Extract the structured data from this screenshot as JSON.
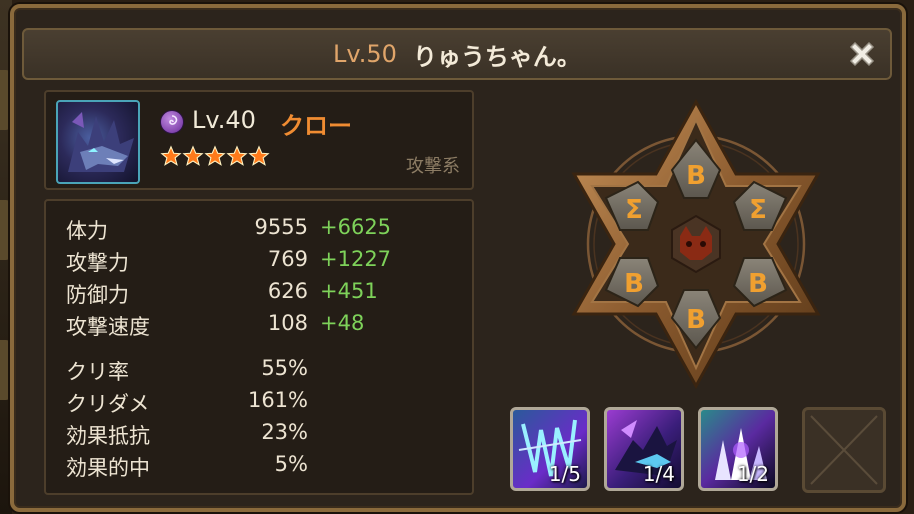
{
  "header": {
    "level_label": "Lv.50",
    "player_name": "りゅうちゃん。",
    "close_icon": "close-x-icon"
  },
  "monster": {
    "element_icon": "dark-element-icon",
    "level_label": "Lv.40",
    "name": "クロー",
    "stars": 5,
    "type": "攻撃系",
    "colors": {
      "name": "#f08c32",
      "bonus": "#7ed25a",
      "star": "#ff7a1a"
    }
  },
  "stats": {
    "main": [
      {
        "label": "体力",
        "base": "9555",
        "bonus": "+6625"
      },
      {
        "label": "攻撃力",
        "base": "769",
        "bonus": "+1227"
      },
      {
        "label": "防御力",
        "base": "626",
        "bonus": "+451"
      },
      {
        "label": "攻撃速度",
        "base": "108",
        "bonus": "+48"
      }
    ],
    "sub": [
      {
        "label": "クリ率",
        "value": "55%"
      },
      {
        "label": "クリダメ",
        "value": "161%"
      },
      {
        "label": "効果抵抗",
        "value": "23%"
      },
      {
        "label": "効果的中",
        "value": "5%"
      }
    ]
  },
  "runes": {
    "slots": [
      {
        "slot": 1,
        "glyph": "B"
      },
      {
        "slot": 2,
        "glyph": "Σ"
      },
      {
        "slot": 3,
        "glyph": "B"
      },
      {
        "slot": 4,
        "glyph": "B"
      },
      {
        "slot": 5,
        "glyph": "B"
      },
      {
        "slot": 6,
        "glyph": "Σ"
      }
    ],
    "center_icon": "demon-skull-icon"
  },
  "skills": [
    {
      "icon": "purple-claw-skill-icon",
      "level": "1/5"
    },
    {
      "icon": "dark-wolf-skill-icon",
      "level": "1/4"
    },
    {
      "icon": "crystal-shard-skill-icon",
      "level": "1/2"
    },
    {
      "icon": "empty-skill-slot-icon",
      "level": ""
    }
  ]
}
